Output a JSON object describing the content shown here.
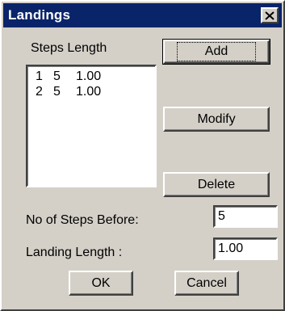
{
  "window": {
    "title": "Landings",
    "close_glyph": "close-icon"
  },
  "list": {
    "header": "Steps Length",
    "rows": [
      {
        "index": "1",
        "steps": "5",
        "length": "1.00"
      },
      {
        "index": "2",
        "steps": "5",
        "length": "1.00"
      }
    ]
  },
  "buttons": {
    "add": "Add",
    "modify": "Modify",
    "delete": "Delete",
    "ok": "OK",
    "cancel": "Cancel"
  },
  "fields": {
    "steps_before_label": "No of Steps Before:",
    "steps_before_value": "5",
    "landing_length_label": "Landing Length :",
    "landing_length_value": "1.00"
  },
  "colors": {
    "titlebar": "#0a246a",
    "face": "#d4d0c8"
  }
}
